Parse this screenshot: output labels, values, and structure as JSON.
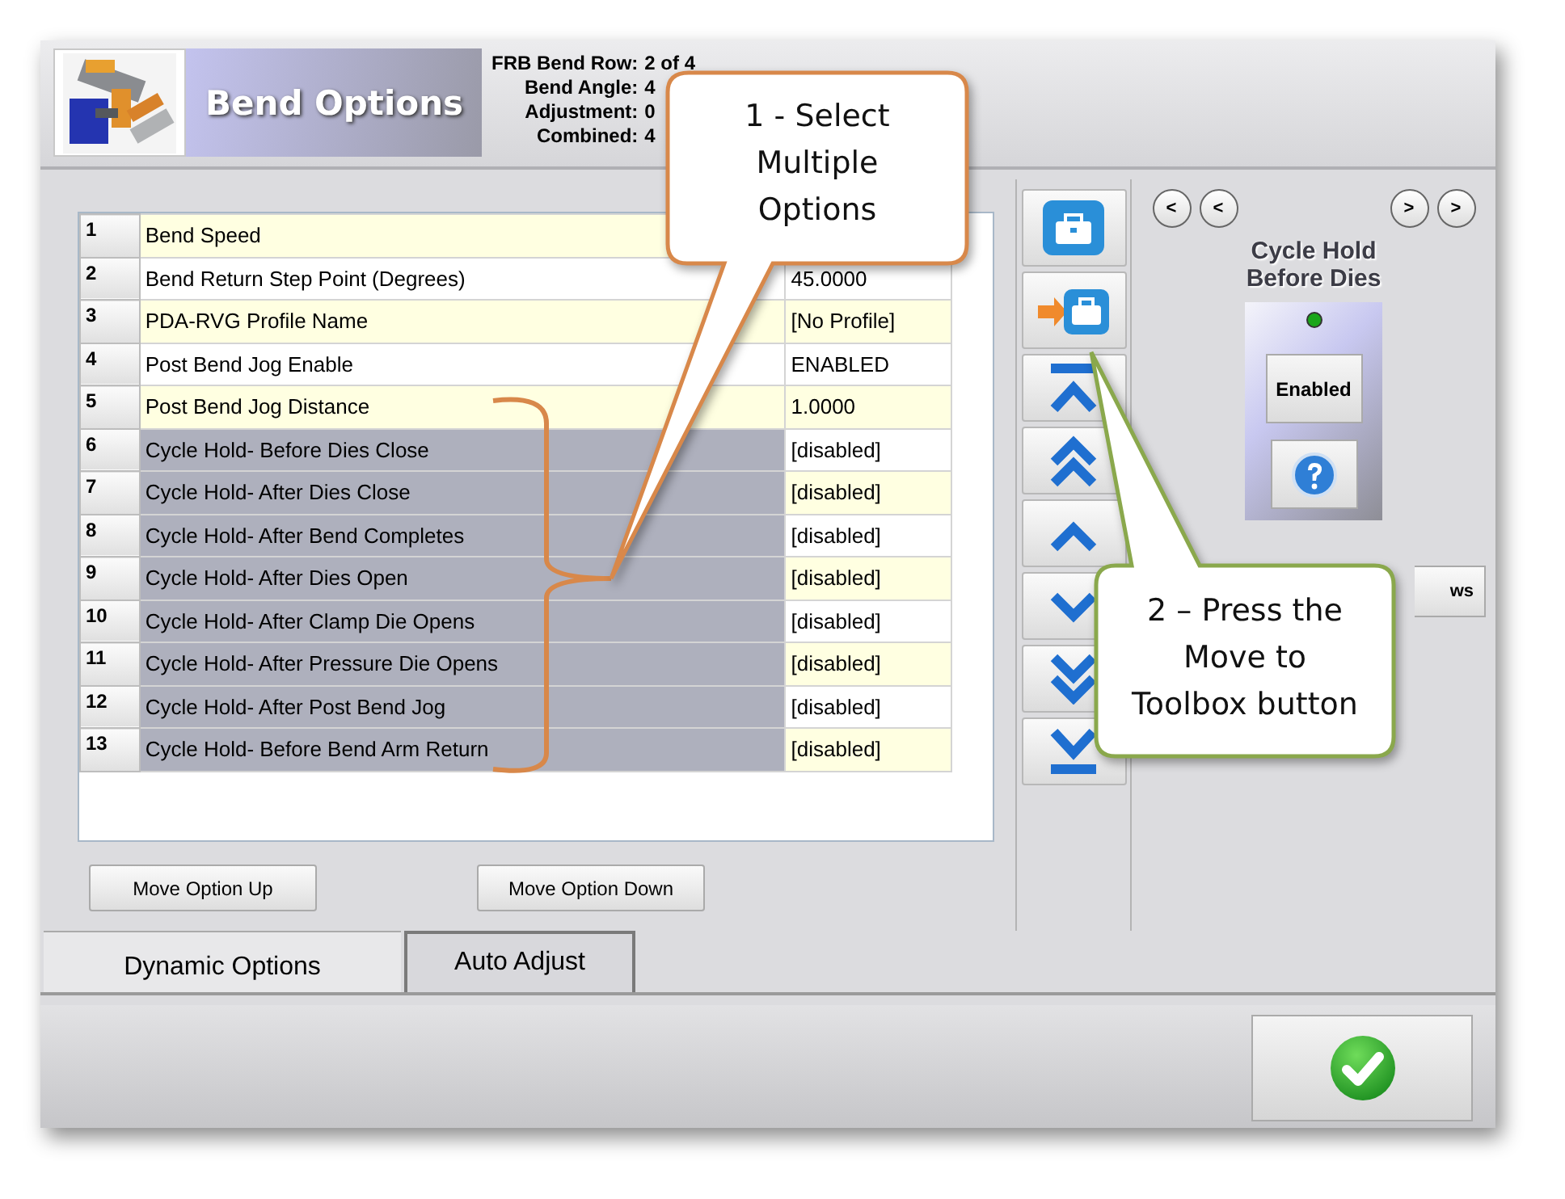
{
  "header": {
    "title": "Bend Options",
    "fields": [
      {
        "label": "FRB Bend Row:",
        "value": "2 of 4"
      },
      {
        "label": "Bend Angle:",
        "value": "4"
      },
      {
        "label": "Adjustment:",
        "value": "0"
      },
      {
        "label": "Combined:",
        "value": "4"
      }
    ]
  },
  "table": {
    "rows": [
      {
        "number": "1",
        "name": "Bend Speed",
        "selected": false
      },
      {
        "number": "2",
        "name": "Bend Return Step Point (Degrees)",
        "value": "45.0000",
        "selected": false
      },
      {
        "number": "3",
        "name": "PDA-RVG Profile Name",
        "value": "[No Profile]",
        "selected": false
      },
      {
        "number": "4",
        "name": "Post Bend Jog Enable",
        "value": "ENABLED",
        "selected": false
      },
      {
        "number": "5",
        "name": "Post Bend Jog Distance",
        "value": "1.0000",
        "selected": false
      },
      {
        "number": "6",
        "name": "Cycle Hold- Before Dies Close",
        "value": "[disabled]",
        "selected": true
      },
      {
        "number": "7",
        "name": "Cycle Hold- After Dies Close",
        "value": "[disabled]",
        "selected": true
      },
      {
        "number": "8",
        "name": "Cycle Hold- After Bend Completes",
        "value": "[disabled]",
        "selected": true
      },
      {
        "number": "9",
        "name": "Cycle Hold- After Dies Open",
        "value": "[disabled]",
        "selected": true
      },
      {
        "number": "10",
        "name": "Cycle Hold- After Clamp Die Opens",
        "value": "[disabled]",
        "selected": true
      },
      {
        "number": "11",
        "name": "Cycle Hold- After Pressure Die Opens",
        "value": "[disabled]",
        "selected": true
      },
      {
        "number": "12",
        "name": "Cycle Hold- After Post Bend Jog",
        "value": "[disabled]",
        "selected": true
      },
      {
        "number": "13",
        "name": "Cycle Hold- Before Bend Arm Return",
        "value": "[disabled]",
        "selected": true
      }
    ]
  },
  "option_buttons": [
    "Move Option Up",
    "Move Option Down"
  ],
  "toolbar": [
    {
      "kind": "toolbox"
    },
    {
      "kind": "to-toolbox"
    },
    {
      "kind": "top"
    },
    {
      "kind": "page-up"
    },
    {
      "kind": "up"
    },
    {
      "kind": "down"
    },
    {
      "kind": "page-down"
    },
    {
      "kind": "bottom"
    }
  ],
  "detail": {
    "nav_left": [
      "<",
      "<"
    ],
    "nav_right": [
      ">",
      ">"
    ],
    "title": "Cycle Hold Before Dies",
    "indicator_on": true,
    "state_button": "Enabled",
    "partial_button": "ws"
  },
  "tabs": [
    {
      "label": "Dynamic Options",
      "selected": true
    },
    {
      "label": "Auto Adjust",
      "selected": false
    }
  ],
  "callouts": [
    {
      "lines": [
        "1 - Select",
        "Multiple",
        "Options"
      ],
      "color": "#d8884a"
    },
    {
      "lines": [
        "2 – Press the",
        "Move to",
        "Toolbox button"
      ],
      "color": "#8aa84c"
    }
  ]
}
